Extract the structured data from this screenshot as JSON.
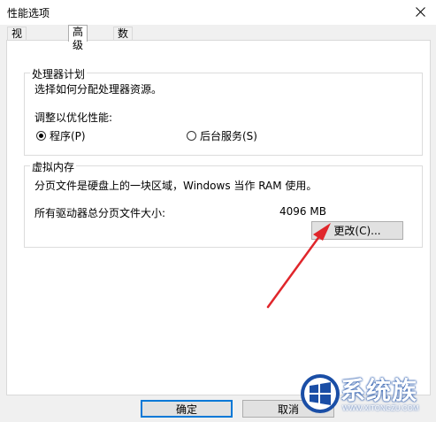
{
  "window": {
    "title": "性能选项"
  },
  "tabs": [
    {
      "label": "视觉效果"
    },
    {
      "label": "高级"
    },
    {
      "label": "数据执行保护"
    }
  ],
  "processor": {
    "group_title": "处理器计划",
    "description": "选择如何分配处理器资源。",
    "adjust_label": "调整以优化性能:",
    "options": [
      {
        "label": "程序(P)",
        "checked": true
      },
      {
        "label": "后台服务(S)",
        "checked": false
      }
    ]
  },
  "virtual_memory": {
    "group_title": "虚拟内存",
    "description": "分页文件是硬盘上的一块区域，Windows 当作 RAM 使用。",
    "total_label": "所有驱动器总分页文件大小:",
    "total_value": "4096 MB",
    "change_button": "更改(C)..."
  },
  "footer": {
    "ok_label": "确定",
    "cancel_label": "取消"
  },
  "watermark": {
    "brand_cn": "系统族",
    "brand_url": "WWW.XITONGZU.COM"
  },
  "colors": {
    "arrow": "#e0262b",
    "accent": "#0078d7",
    "logo_blue": "#1a4ea6"
  }
}
